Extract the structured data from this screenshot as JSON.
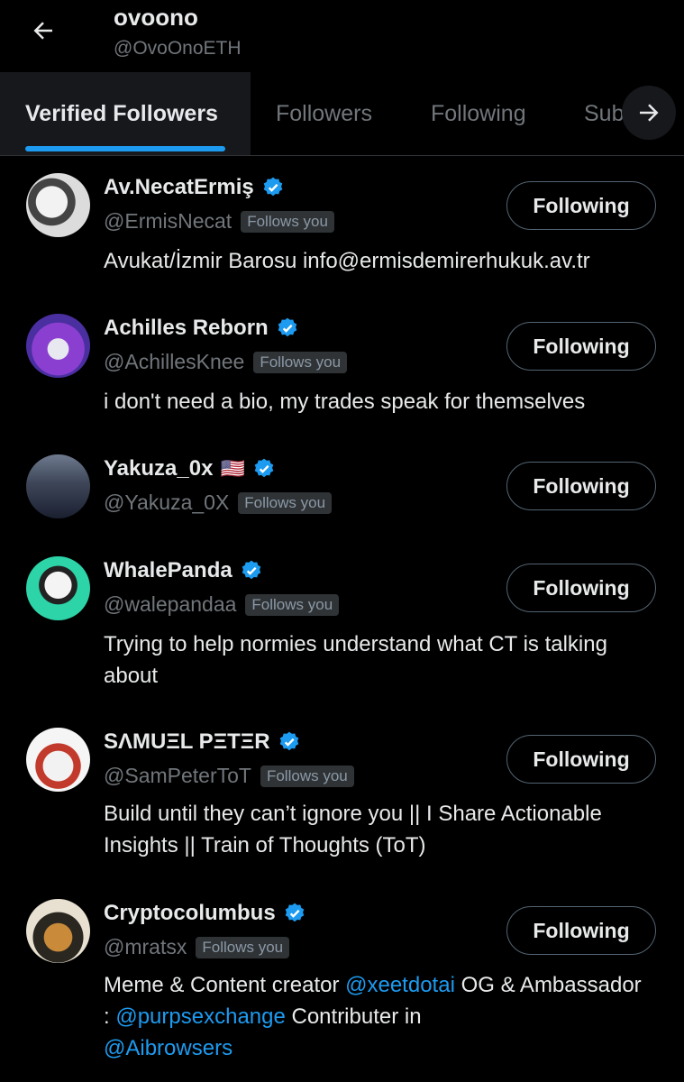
{
  "header": {
    "name": "ovoono",
    "handle": "@OvoOnoETH"
  },
  "tabs": [
    "Verified Followers",
    "Followers",
    "Following",
    "Subscriptions"
  ],
  "tabs_visible_partial": "Sub",
  "colors": {
    "accent": "#1d9bf0",
    "background": "#000000",
    "muted": "#71767b"
  },
  "users": [
    {
      "name": "Av.NecatErmiş",
      "handle": "@ErmisNecat",
      "follows_you": "Follows you",
      "button": "Following",
      "bio": "Avukat/İzmir Barosu info@ermisdemirerhukuk.av.tr"
    },
    {
      "name": "Achilles Reborn",
      "handle": "@AchillesKnee",
      "follows_you": "Follows you",
      "button": "Following",
      "bio": "i don't need a bio, my trades speak for themselves"
    },
    {
      "name": "Yakuza_0x",
      "flag": "🇺🇸",
      "handle": "@Yakuza_0X",
      "follows_you": "Follows you",
      "button": "Following",
      "bio": ""
    },
    {
      "name": "WhalePanda",
      "handle": "@walepandaa",
      "follows_you": "Follows you",
      "button": "Following",
      "bio": "Trying to help normies understand what CT is talking about"
    },
    {
      "name": "SΛMUΞL PΞTΞR",
      "handle": "@SamPeterToT",
      "follows_you": "Follows you",
      "button": "Following",
      "bio": "Build until they can’t ignore you || I Share Actionable Insights || Train of Thoughts (ToT)"
    },
    {
      "name": "Cryptocolumbus",
      "handle": "@mratsx",
      "follows_you": "Follows you",
      "button": "Following",
      "bio_parts": [
        "Meme & Content creator ",
        "@xeetdotai",
        " OG & Ambassador : ",
        "@purpsexchange",
        " Contributer in ",
        "@Aibrowsers"
      ]
    }
  ]
}
